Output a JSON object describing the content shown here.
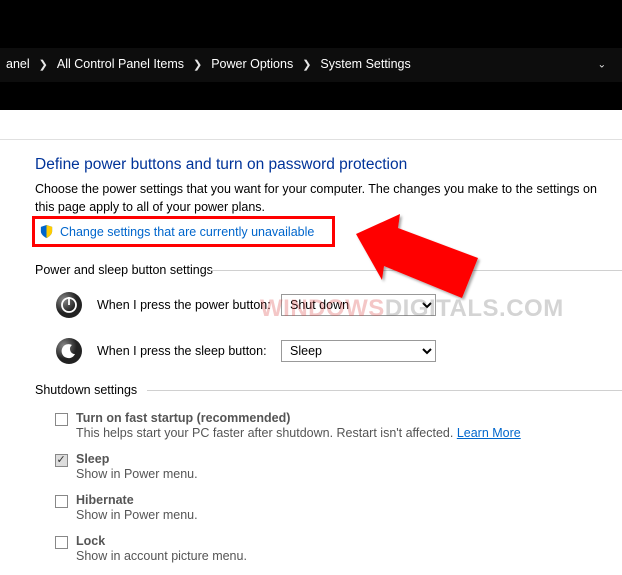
{
  "breadcrumb": {
    "items": [
      "anel",
      "All Control Panel Items",
      "Power Options",
      "System Settings"
    ]
  },
  "header": {
    "title": "Define power buttons and turn on password protection",
    "description": "Choose the power settings that you want for your computer. The changes you make to the settings on this page apply to all of your power plans.",
    "change_link": "Change settings that are currently unavailable"
  },
  "sections": {
    "power_sleep": {
      "heading": "Power and sleep button settings",
      "power_label": "When I press the power button:",
      "power_value": "Shut down",
      "sleep_label": "When I press the sleep button:",
      "sleep_value": "Sleep"
    },
    "shutdown": {
      "heading": "Shutdown settings",
      "items": [
        {
          "title": "Turn on fast startup (recommended)",
          "sub": "This helps start your PC faster after shutdown. Restart isn't affected.",
          "learn": "Learn More",
          "checked": false
        },
        {
          "title": "Sleep",
          "sub": "Show in Power menu.",
          "checked": true
        },
        {
          "title": "Hibernate",
          "sub": "Show in Power menu.",
          "checked": false
        },
        {
          "title": "Lock",
          "sub": "Show in account picture menu.",
          "checked": false
        }
      ]
    }
  },
  "watermark": {
    "a": "WINDOWS",
    "b": "DIGITALS",
    "c": ".COM"
  }
}
